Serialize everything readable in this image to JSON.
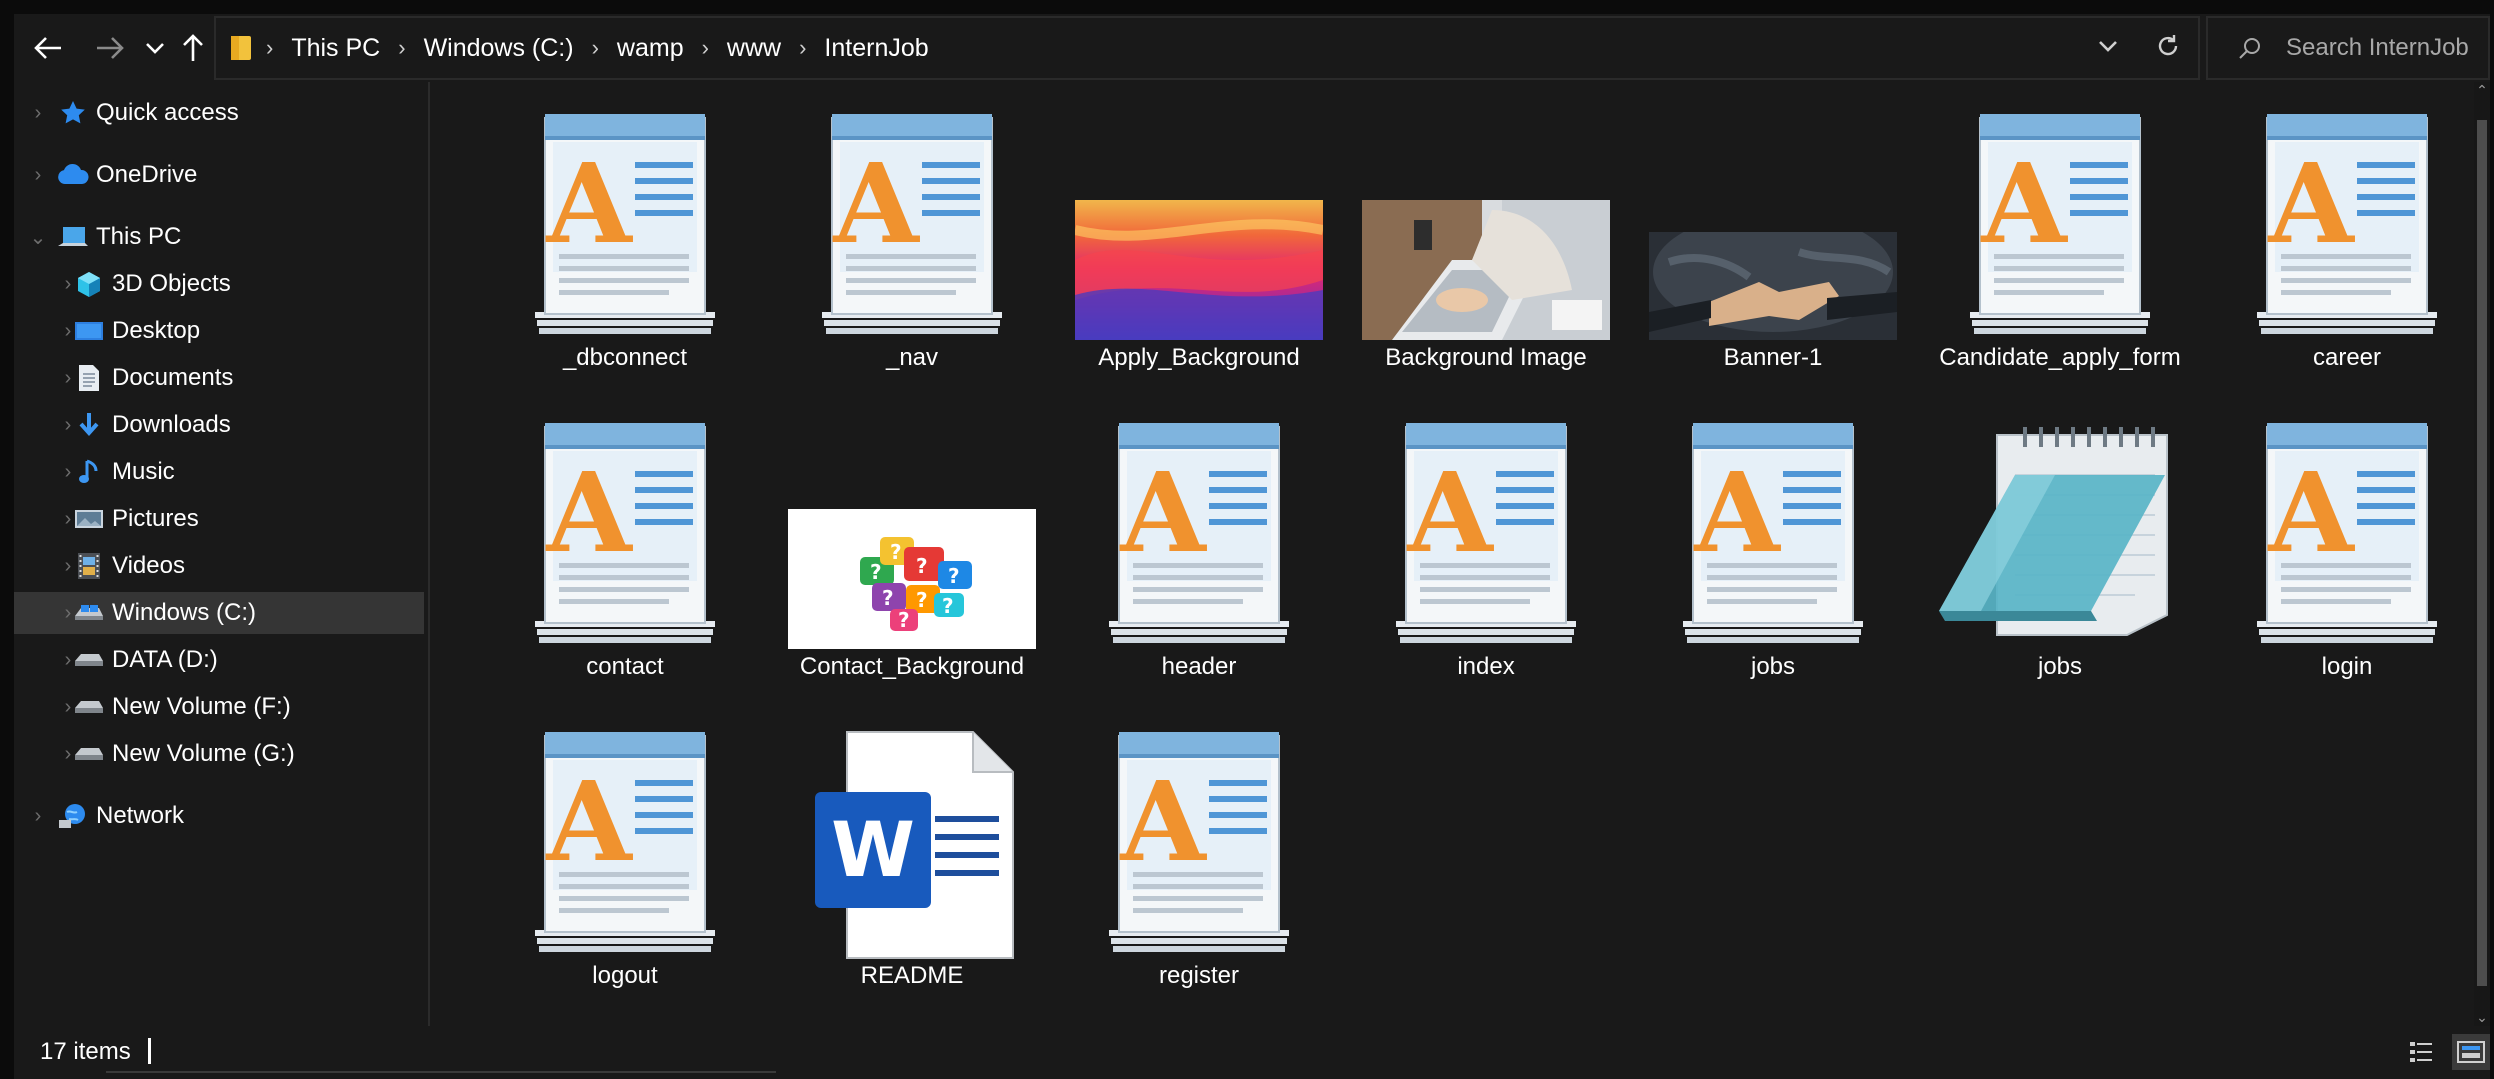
{
  "address": {
    "crumbs": [
      "This PC",
      "Windows (C:)",
      "wamp",
      "www",
      "InternJob"
    ]
  },
  "search": {
    "placeholder": "Search InternJob"
  },
  "nav_pane": {
    "items": [
      {
        "label": "Quick access",
        "icon": "star-icon"
      },
      {
        "label": "OneDrive",
        "icon": "cloud-icon"
      },
      {
        "label": "This PC",
        "icon": "computer-icon"
      },
      {
        "label": "3D Objects",
        "icon": "cube-icon"
      },
      {
        "label": "Desktop",
        "icon": "desktop-icon"
      },
      {
        "label": "Documents",
        "icon": "document-icon"
      },
      {
        "label": "Downloads",
        "icon": "download-arrow-icon"
      },
      {
        "label": "Music",
        "icon": "music-note-icon"
      },
      {
        "label": "Pictures",
        "icon": "pictures-icon"
      },
      {
        "label": "Videos",
        "icon": "film-icon"
      },
      {
        "label": "Windows (C:)",
        "icon": "system-drive-icon"
      },
      {
        "label": "DATA (D:)",
        "icon": "drive-icon"
      },
      {
        "label": "New Volume (F:)",
        "icon": "drive-icon"
      },
      {
        "label": "New Volume (G:)",
        "icon": "drive-icon"
      },
      {
        "label": "Network",
        "icon": "network-icon"
      }
    ],
    "selected": "Windows (C:)"
  },
  "files": [
    {
      "name": "_dbconnect",
      "kind": "wordpad"
    },
    {
      "name": "_nav",
      "kind": "wordpad"
    },
    {
      "name": "Apply_Background",
      "kind": "image-gradient"
    },
    {
      "name": "Background Image",
      "kind": "image-laptop"
    },
    {
      "name": "Banner-1",
      "kind": "image-handshake"
    },
    {
      "name": "Candidate_apply_form",
      "kind": "wordpad"
    },
    {
      "name": "career",
      "kind": "wordpad"
    },
    {
      "name": "contact",
      "kind": "wordpad"
    },
    {
      "name": "Contact_Background",
      "kind": "image-question-bubbles"
    },
    {
      "name": "header",
      "kind": "wordpad"
    },
    {
      "name": "index",
      "kind": "wordpad"
    },
    {
      "name": "jobs",
      "kind": "wordpad"
    },
    {
      "name": "jobs",
      "kind": "notepad"
    },
    {
      "name": "login",
      "kind": "wordpad"
    },
    {
      "name": "logout",
      "kind": "wordpad"
    },
    {
      "name": "README",
      "kind": "word-document"
    },
    {
      "name": "register",
      "kind": "wordpad"
    }
  ],
  "status": {
    "item_count": "17 items"
  },
  "colors": {
    "background": "#191919",
    "selected_row": "#353535",
    "wordpad_orange": "#f0922e",
    "word_blue": "#185abd"
  }
}
